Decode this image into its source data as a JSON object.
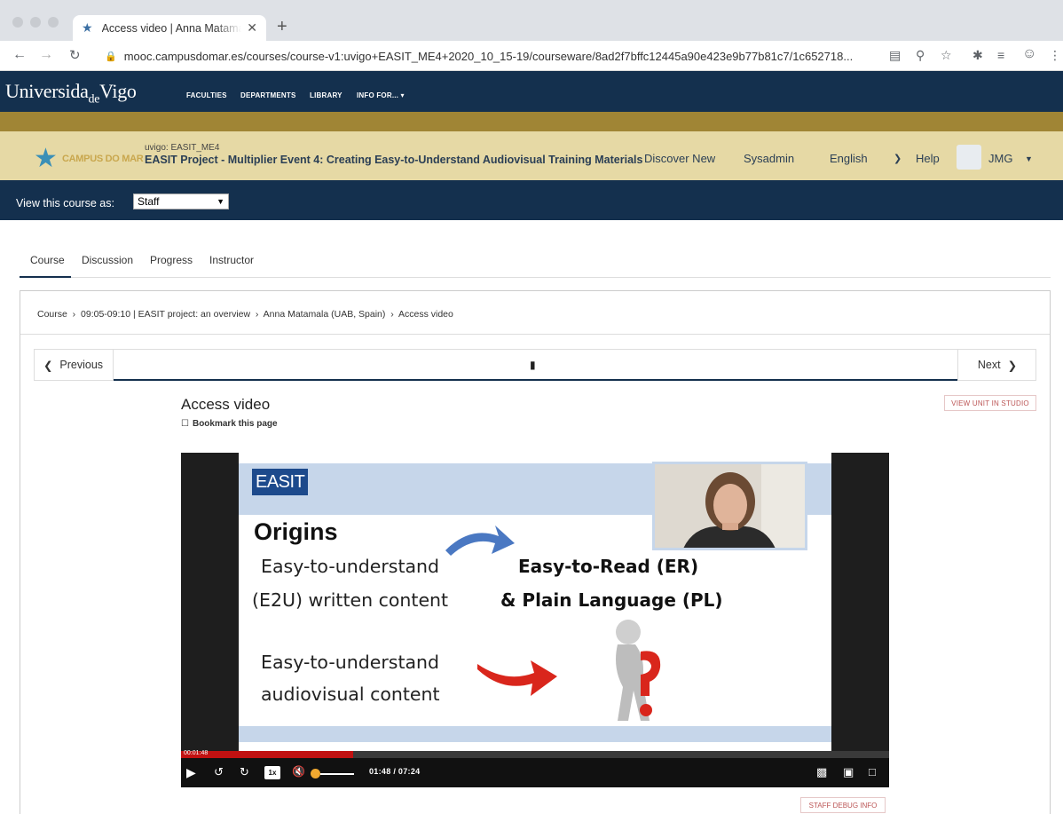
{
  "browser": {
    "tab_title": "Access video | Anna Matamala",
    "new_tab": "+",
    "url": "mooc.campusdomar.es/courses/course-v1:uvigo+EASIT_ME4+2020_10_15-19/courseware/8ad2f7bffc12445a90e423e9b77b81c7/1c652718..."
  },
  "site": {
    "logo_a": "Universida",
    "logo_b": "de",
    "logo_c": "Vigo",
    "nav": [
      "FACULTIES",
      "DEPARTMENTS",
      "LIBRARY",
      "INFO FOR... ▾"
    ]
  },
  "course": {
    "brand": "CAMPUS DO MAR",
    "org": "uvigo: EASIT_ME4",
    "name": "EASIT Project - Multiplier Event 4: Creating Easy-to-Understand Audiovisual Training Materials",
    "discover": "Discover New",
    "sysadmin": "Sysadmin",
    "language": "English",
    "help": "Help",
    "user": "JMG",
    "view_as_label": "View this course as:",
    "view_as_value": "Staff"
  },
  "tabs": [
    "Course",
    "Discussion",
    "Progress",
    "Instructor"
  ],
  "breadcrumb": "Course  ›  09:05-09:10 | EASIT project: an overview  ›  Anna Matamala (UAB, Spain)  ›  Access video",
  "sequence": {
    "previous": "Previous",
    "next": "Next"
  },
  "unit": {
    "title": "Access video",
    "bookmark": "Bookmark this page",
    "studio_button": "VIEW UNIT IN STUDIO",
    "debug_button": "STAFF DEBUG INFO"
  },
  "slide": {
    "logo": "EASIT",
    "heading": "Origins",
    "left1a": "Easy-to-understand",
    "left1b": "(E2U) written content",
    "right1a": "Easy-to-Read (ER)",
    "right1b": "& Plain Language (PL)",
    "left2a": "Easy-to-understand",
    "left2b": "audiovisual content"
  },
  "player": {
    "elapsed_label": "00:01:48",
    "time": "01:48 / 07:24",
    "speed": "1x",
    "progress_fraction": 0.243,
    "accent": "#c11111",
    "volume_color": "#f0a830"
  },
  "colors": {
    "navy": "#14304e",
    "gold": "#a08535",
    "sand": "#e6d9a5"
  }
}
